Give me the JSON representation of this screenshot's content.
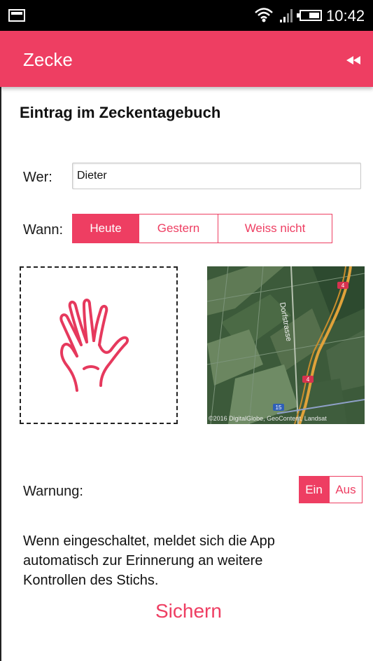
{
  "status_bar": {
    "time": "10:42",
    "icons": [
      "notification-icon",
      "wifi-icon",
      "signal-icon",
      "battery-icon"
    ]
  },
  "app_bar": {
    "title": "Zecke",
    "action_icon": "rewind-icon"
  },
  "form": {
    "heading": "Eintrag im Zeckentagebuch",
    "wer": {
      "label": "Wer:",
      "value": "Dieter",
      "placeholder": ""
    },
    "wann": {
      "label": "Wann:",
      "options": [
        "Heute",
        "Gestern",
        "Weiss nicht"
      ],
      "selected": "Heute"
    },
    "body_picker_icon": "hand-icon",
    "map": {
      "road_label": "Dorfstrasse",
      "credit": "©2016 DigitalGlobe, GeoContent, Landsat",
      "route_badges": [
        "4",
        "4",
        "15"
      ]
    },
    "warnung": {
      "label": "Warnung:",
      "on_label": "Ein",
      "off_label": "Aus",
      "selected": "Ein"
    },
    "description": "Wenn eingeschaltet, meldet sich die App automatisch zur Erinnerung an weitere Kontrollen des Stichs.",
    "save_label": "Sichern"
  },
  "colors": {
    "accent": "#ee3e62",
    "status_bar": "#000000",
    "map_green": "#3c5a3a",
    "road": "#e0a23a"
  }
}
